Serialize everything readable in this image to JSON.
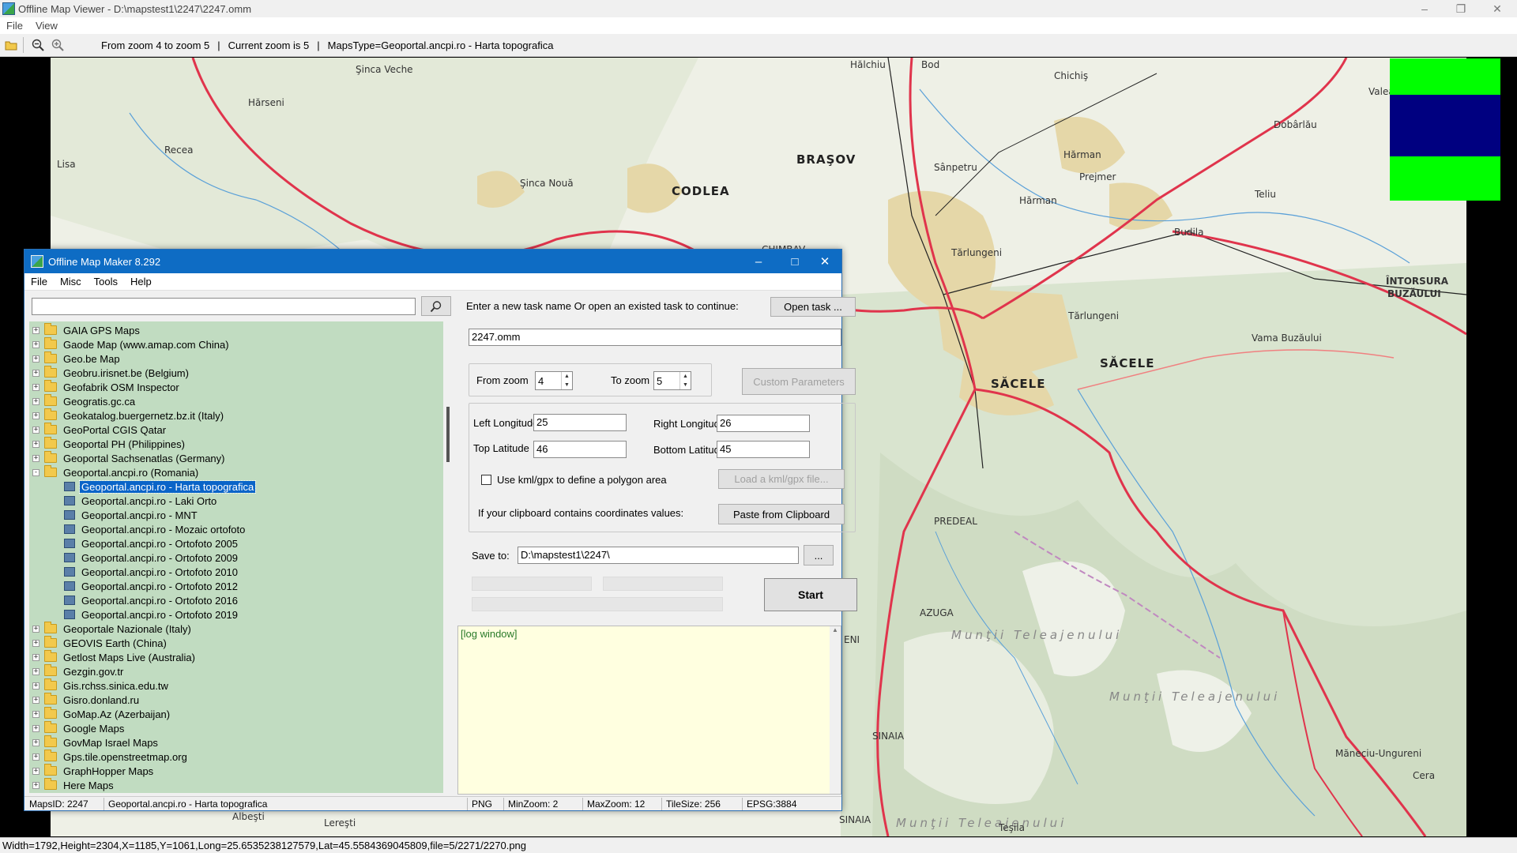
{
  "viewer": {
    "title": "Offline Map Viewer - D:\\mapstest1\\2247\\2247.omm",
    "menu": [
      "File",
      "View"
    ],
    "zoom_range_text": "From zoom 4 to zoom 5",
    "current_zoom_text": "Current zoom is 5",
    "maps_type_text": "MapsType=Geoportal.ancpi.ro - Harta topografica",
    "statusbar": "Width=1792,Height=2304,X=1185,Y=1061,Long=25.6535238127579,Lat=45.5584369045809,file=5/2271/2270.png",
    "icons": [
      "open-folder-icon",
      "zoom-out-icon",
      "zoom-in-icon"
    ]
  },
  "map": {
    "labels": {
      "sinca_veche": "Şinca Veche",
      "harseni": "Hărseni",
      "recea": "Recea",
      "lisa": "Lisa",
      "sinca_noua": "Şinca Nouă",
      "codlea": "CODLEA",
      "brasov": "BRAŞOV",
      "halchiu": "Hălchiu",
      "bod": "Bod",
      "chichis": "Chichiş",
      "valea_ma": "Valea Ma",
      "dobarlau": "Dobârlău",
      "sanpetru": "Sânpetru",
      "harman1": "Hărman",
      "prejmer": "Prejmer",
      "harman2": "Hărman",
      "teliu": "Teliu",
      "budila": "Budila",
      "tarlungeni1": "Tărlungeni",
      "tarlungeni2": "Tărlungeni",
      "intorsura": "ÎNTORSURA",
      "buzaului": "BUZĂULUI",
      "vama_buzaului": "Vama Buzăului",
      "sacele_big": "SĂCELE",
      "sacele_right": "SĂCELE",
      "predeal": "PREDEAL",
      "azuga": "AZUGA",
      "muntii_t1": "Munţii Teleajenului",
      "muntii_t2": "Munţii Teleajenului",
      "muntii_t3": "Munţii Teleajenului",
      "sinaia1": "SINAIA",
      "sinaia2": "SINAIA",
      "maneciu": "Măneciu-Ungureni",
      "tesila": "Teşila",
      "leresti": "Lereşti",
      "albesti": "Albeşti",
      "eni": "ENI",
      "chimbav": "CHIMBAV",
      "ceral": "Cera"
    }
  },
  "dialog": {
    "title": "Offline Map Maker 8.292",
    "menu": [
      "File",
      "Misc",
      "Tools",
      "Help"
    ],
    "search": {
      "value": "",
      "placeholder": ""
    },
    "tree": [
      {
        "label": "GAIA GPS Maps",
        "type": "folder",
        "level": 0,
        "expander": "+"
      },
      {
        "label": "Gaode Map (www.amap.com China)",
        "type": "folder",
        "level": 0,
        "expander": "+"
      },
      {
        "label": "Geo.be Map",
        "type": "folder",
        "level": 0,
        "expander": "+"
      },
      {
        "label": "Geobru.irisnet.be (Belgium)",
        "type": "folder",
        "level": 0,
        "expander": "+"
      },
      {
        "label": "Geofabrik OSM Inspector",
        "type": "folder",
        "level": 0,
        "expander": "+"
      },
      {
        "label": "Geogratis.gc.ca",
        "type": "folder",
        "level": 0,
        "expander": "+"
      },
      {
        "label": "Geokatalog.buergernetz.bz.it (Italy)",
        "type": "folder",
        "level": 0,
        "expander": "+"
      },
      {
        "label": "GeoPortal CGIS Qatar",
        "type": "folder",
        "level": 0,
        "expander": "+"
      },
      {
        "label": "Geoportal PH (Philippines)",
        "type": "folder",
        "level": 0,
        "expander": "+"
      },
      {
        "label": "Geoportal Sachsenatlas (Germany)",
        "type": "folder",
        "level": 0,
        "expander": "+"
      },
      {
        "label": "Geoportal.ancpi.ro (Romania)",
        "type": "folder",
        "level": 0,
        "expander": "-"
      },
      {
        "label": "Geoportal.ancpi.ro - Harta topografica",
        "type": "map",
        "level": 1,
        "selected": true
      },
      {
        "label": "Geoportal.ancpi.ro - Laki Orto",
        "type": "map",
        "level": 1
      },
      {
        "label": "Geoportal.ancpi.ro - MNT",
        "type": "map",
        "level": 1
      },
      {
        "label": "Geoportal.ancpi.ro - Mozaic ortofoto",
        "type": "map",
        "level": 1
      },
      {
        "label": "Geoportal.ancpi.ro - Ortofoto 2005",
        "type": "map",
        "level": 1
      },
      {
        "label": "Geoportal.ancpi.ro - Ortofoto 2009",
        "type": "map",
        "level": 1
      },
      {
        "label": "Geoportal.ancpi.ro - Ortofoto 2010",
        "type": "map",
        "level": 1
      },
      {
        "label": "Geoportal.ancpi.ro - Ortofoto 2012",
        "type": "map",
        "level": 1
      },
      {
        "label": "Geoportal.ancpi.ro - Ortofoto 2016",
        "type": "map",
        "level": 1
      },
      {
        "label": "Geoportal.ancpi.ro - Ortofoto 2019",
        "type": "map",
        "level": 1
      },
      {
        "label": "Geoportale Nazionale (Italy)",
        "type": "folder",
        "level": 0,
        "expander": "+"
      },
      {
        "label": "GEOVIS Earth (China)",
        "type": "folder",
        "level": 0,
        "expander": "+"
      },
      {
        "label": "Getlost Maps Live (Australia)",
        "type": "folder",
        "level": 0,
        "expander": "+"
      },
      {
        "label": "Gezgin.gov.tr",
        "type": "folder",
        "level": 0,
        "expander": "+"
      },
      {
        "label": "Gis.rchss.sinica.edu.tw",
        "type": "folder",
        "level": 0,
        "expander": "+"
      },
      {
        "label": "Gisro.donland.ru",
        "type": "folder",
        "level": 0,
        "expander": "+"
      },
      {
        "label": "GoMap.Az (Azerbaijan)",
        "type": "folder",
        "level": 0,
        "expander": "+"
      },
      {
        "label": "Google Maps",
        "type": "folder",
        "level": 0,
        "expander": "+"
      },
      {
        "label": "GovMap Israel Maps",
        "type": "folder",
        "level": 0,
        "expander": "+"
      },
      {
        "label": "Gps.tile.openstreetmap.org",
        "type": "folder",
        "level": 0,
        "expander": "+"
      },
      {
        "label": "GraphHopper Maps",
        "type": "folder",
        "level": 0,
        "expander": "+"
      },
      {
        "label": "Here Maps",
        "type": "folder",
        "level": 0,
        "expander": "+"
      }
    ],
    "task_prompt": "Enter a new task name Or open an existed task to continue:",
    "open_task_label": "Open task ...",
    "task_name": "2247.omm",
    "from_zoom_label": "From zoom",
    "from_zoom": "4",
    "to_zoom_label": "To zoom",
    "to_zoom": "5",
    "custom_params_label": "Custom Parameters",
    "left_lon_label": "Left Longitude",
    "left_lon": "25",
    "right_lon_label": "Right Longitude",
    "right_lon": "26",
    "top_lat_label": "Top Latitude",
    "top_lat": "46",
    "bottom_lat_label": "Bottom Latitude",
    "bottom_lat": "45",
    "kml_label": "Use kml/gpx to define a polygon area",
    "kml_checked": false,
    "load_kml_label": "Load a kml/gpx file...",
    "clipboard_label": "If your clipboard contains coordinates values:",
    "paste_label": "Paste from Clipboard",
    "save_to_label": "Save to:",
    "save_to": "D:\\mapstest1\\2247\\",
    "browse_label": "...",
    "start_label": "Start",
    "log_text": "[log window]",
    "status": {
      "maps_id": "MapsID: 2247",
      "maps_name": "Geoportal.ancpi.ro - Harta topografica",
      "format": "PNG",
      "min_zoom": "MinZoom: 2",
      "max_zoom": "MaxZoom: 12",
      "tile_size": "TileSize: 256",
      "epsg": "EPSG:3884"
    }
  }
}
